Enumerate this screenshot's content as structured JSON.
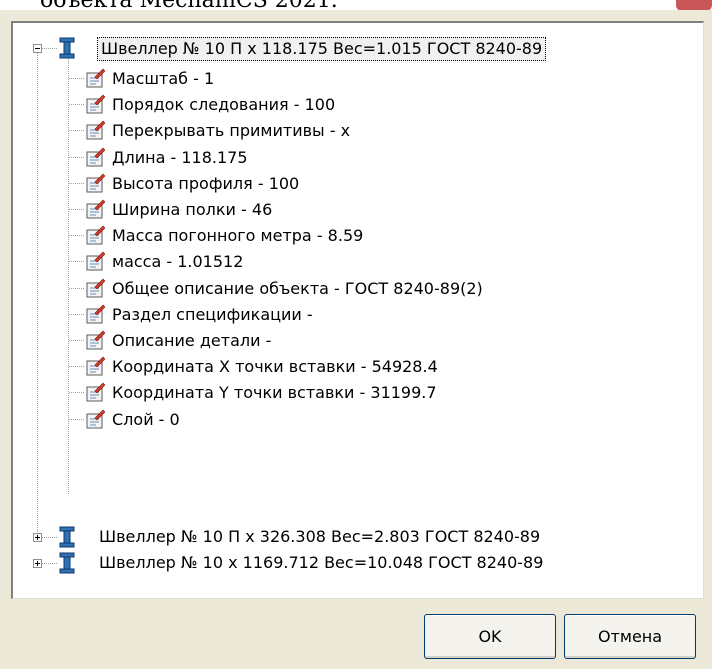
{
  "background_caption": "объекта MechaniCS 2021.",
  "tree": {
    "nodes": [
      {
        "label": "Швеллер № 10 П х 118.175 Вес=1.015 ГОСТ 8240-89",
        "expanded": true,
        "selected": true,
        "icon": "beam-icon",
        "children": [
          {
            "label": "Масштаб - 1",
            "icon": "property-icon"
          },
          {
            "label": "Порядок следования - 100",
            "icon": "property-icon"
          },
          {
            "label": "Перекрывать примитивы - x",
            "icon": "property-icon"
          },
          {
            "label": "Длина - 118.175",
            "icon": "property-icon"
          },
          {
            "label": "Высота профиля - 100",
            "icon": "property-icon"
          },
          {
            "label": "Ширина полки - 46",
            "icon": "property-icon"
          },
          {
            "label": "Масса погонного метра - 8.59",
            "icon": "property-icon"
          },
          {
            "label": "масса - 1.01512",
            "icon": "property-icon"
          },
          {
            "label": "Общее описание объекта - ГОСТ 8240-89(2)",
            "icon": "property-icon"
          },
          {
            "label": "Раздел спецификации -",
            "icon": "property-icon"
          },
          {
            "label": "Описание детали -",
            "icon": "property-icon"
          },
          {
            "label": "Координата X точки вставки - 54928.4",
            "icon": "property-icon"
          },
          {
            "label": "Координата Y точки вставки - 31199.7",
            "icon": "property-icon"
          },
          {
            "label": "Слой - 0",
            "icon": "property-icon"
          }
        ]
      },
      {
        "label": "Швеллер № 10 П х 326.308 Вес=2.803 ГОСТ 8240-89",
        "expanded": false,
        "icon": "beam-icon"
      },
      {
        "label": "Швеллер № 10 х 1169.712 Вес=10.048 ГОСТ 8240-89",
        "expanded": false,
        "icon": "beam-icon"
      }
    ]
  },
  "buttons": {
    "ok_label": "OK",
    "cancel_label": "Отмена"
  },
  "colors": {
    "dialog_bg": "#ece9d8",
    "button_border": "#003c74",
    "beam_icon": "#1b4f8a",
    "property_icon_accent": "#d33a2c"
  }
}
